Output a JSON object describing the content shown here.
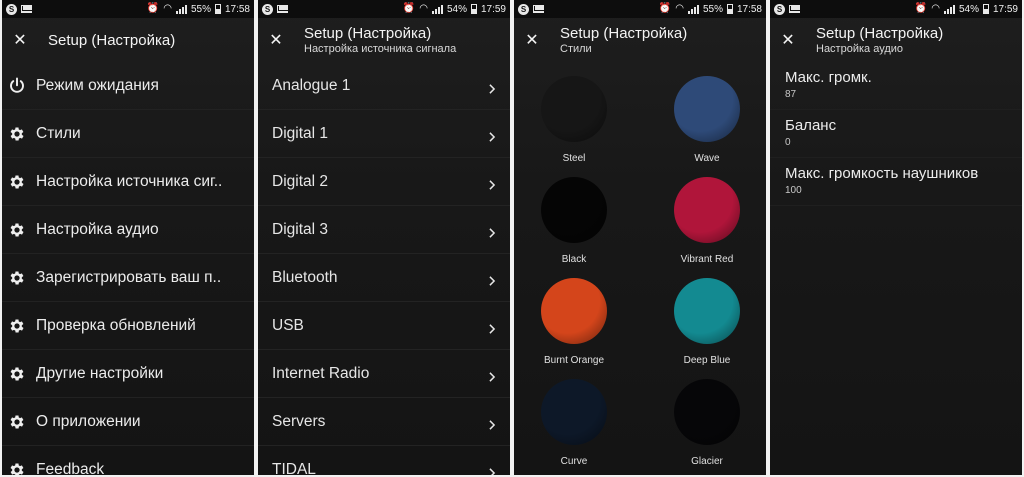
{
  "status_bars": [
    {
      "battery": "55%",
      "time": "17:58"
    },
    {
      "battery": "54%",
      "time": "17:59"
    },
    {
      "battery": "55%",
      "time": "17:58"
    },
    {
      "battery": "54%",
      "time": "17:59"
    }
  ],
  "screen1": {
    "title": "Setup (Настройка)",
    "items": [
      {
        "icon": "power-icon",
        "label": "Режим ожидания"
      },
      {
        "icon": "gear-icon",
        "label": "Стили"
      },
      {
        "icon": "gear-icon",
        "label": "Настройка источника сиг.."
      },
      {
        "icon": "gear-icon",
        "label": "Настройка аудио"
      },
      {
        "icon": "gear-icon",
        "label": "Зарегистрировать ваш п.."
      },
      {
        "icon": "gear-icon",
        "label": "Проверка обновлений"
      },
      {
        "icon": "gear-icon",
        "label": "Другие настройки"
      },
      {
        "icon": "gear-icon",
        "label": "О приложении"
      },
      {
        "icon": "gear-icon",
        "label": "Feedback"
      }
    ]
  },
  "screen2": {
    "title": "Setup (Настройка)",
    "subtitle": "Настройка источника сигнала",
    "items": [
      "Analogue 1",
      "Digital 1",
      "Digital 2",
      "Digital 3",
      "Bluetooth",
      "USB",
      "Internet Radio",
      "Servers",
      "TIDAL"
    ]
  },
  "screen3": {
    "title": "Setup (Настройка)",
    "subtitle": "Стили",
    "styles": [
      {
        "name": "Steel",
        "color": "#161616"
      },
      {
        "name": "Wave",
        "color": "#2e4a78"
      },
      {
        "name": "Black",
        "color": "#050505"
      },
      {
        "name": "Vibrant Red",
        "color": "#b0153a"
      },
      {
        "name": "Burnt Orange",
        "color": "#d4451b"
      },
      {
        "name": "Deep Blue",
        "color": "#138a91"
      },
      {
        "name": "Curve",
        "color": "#0d1828"
      },
      {
        "name": "Glacier",
        "color": "#060608"
      }
    ]
  },
  "screen4": {
    "title": "Setup (Настройка)",
    "subtitle": "Настройка аудио",
    "items": [
      {
        "label": "Макс. громк.",
        "value": "87"
      },
      {
        "label": "Баланс",
        "value": "0"
      },
      {
        "label": "Макс. громкость наушников",
        "value": "100"
      }
    ]
  }
}
